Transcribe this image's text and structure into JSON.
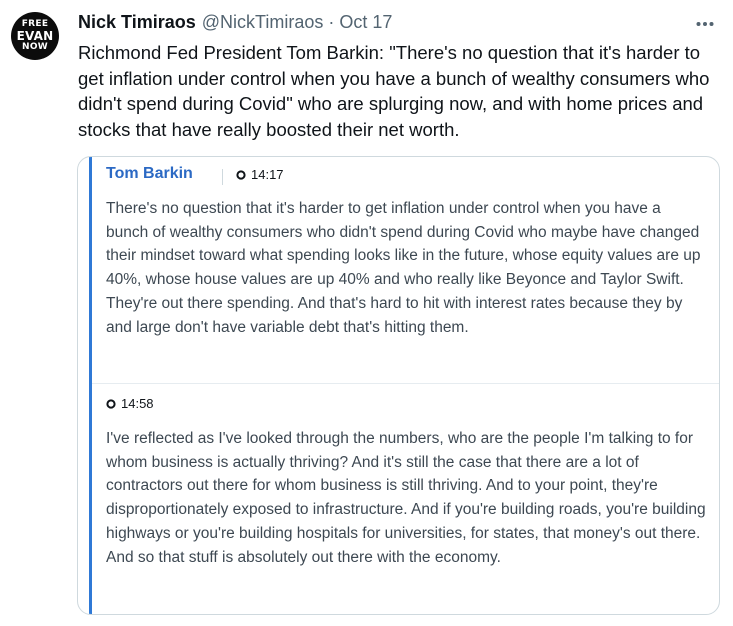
{
  "tweet": {
    "author_name": "Nick Timiraos",
    "handle": "@NickTimiraos",
    "separator": "·",
    "date": "Oct 17",
    "more_icon": "more-horizontal-icon",
    "avatar": {
      "line1": "FREE",
      "line2": "EVAN",
      "line3": "NOW"
    },
    "text": "Richmond Fed President Tom Barkin: \"There's no question that it's harder to get inflation under control when you have a bunch of wealthy consumers who didn't spend during Covid\" who are splurging now, and with home prices and stocks that have really boosted their net worth."
  },
  "quote_card": {
    "speaker": "Tom Barkin",
    "clips": [
      {
        "time": "14:17",
        "text": "There's no question that it's harder to get inflation under control when you have a bunch of wealthy consumers who didn't spend during Covid who maybe have changed their mindset toward what spending looks like in the future, whose equity values are up 40%, whose house values are up 40% and who really like Beyonce and Taylor Swift. They're out there spending. And that's hard to hit with interest rates because they by and large don't have variable debt that's hitting them."
      },
      {
        "time": "14:58",
        "text": "I've reflected as I've looked through the numbers, who are the people I'm talking to for whom business is actually thriving? And it's still the case that there are a lot of contractors out there for whom business is still thriving. And to your point, they're disproportionately exposed to infrastructure. And if you're building roads, you're building highways or you're building hospitals for universities, for states, that money's out there. And so that stuff is absolutely out there with the economy."
      }
    ]
  },
  "colors": {
    "accent_bar": "#2f79d6",
    "speaker_name": "#2b69c4",
    "secondary_text": "#536471",
    "card_border": "#cfd9de"
  }
}
